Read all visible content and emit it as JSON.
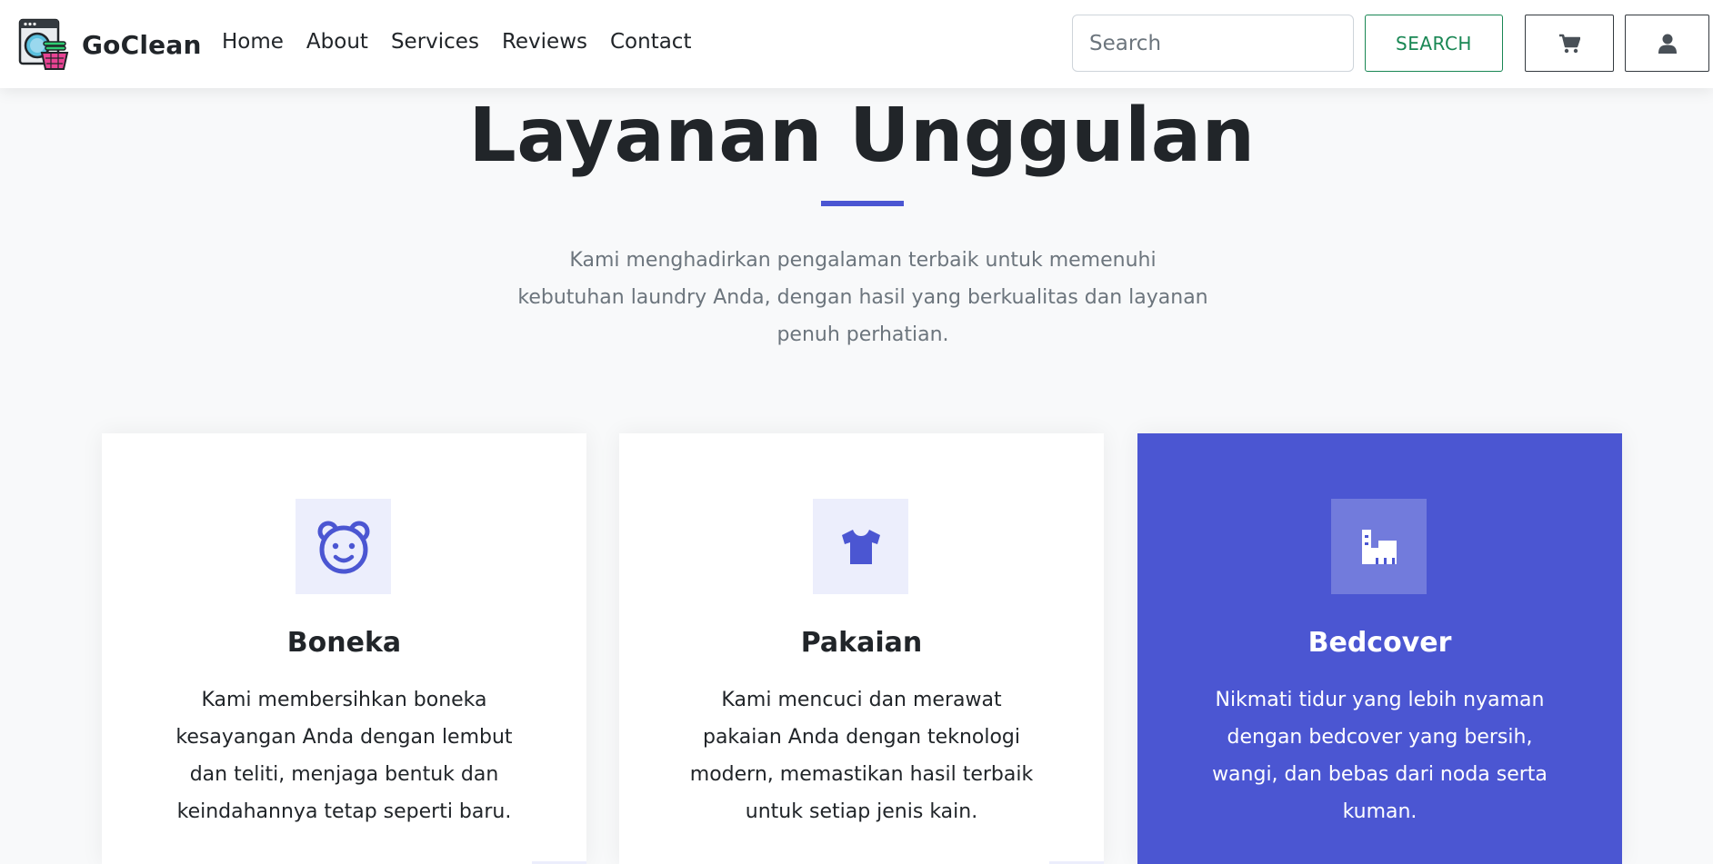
{
  "brand": {
    "name": "GoClean"
  },
  "nav": {
    "links": [
      {
        "label": "Home"
      },
      {
        "label": "About"
      },
      {
        "label": "Services"
      },
      {
        "label": "Reviews"
      },
      {
        "label": "Contact"
      }
    ]
  },
  "search": {
    "placeholder": "Search",
    "button_label": "SEARCH"
  },
  "header_icons": {
    "cart": "cart-icon",
    "user": "user-icon"
  },
  "section": {
    "title": "Layanan Unggulan",
    "description": "Kami menghadirkan pengalaman terbaik untuk memenuhi kebutuhan laundry Anda, dengan hasil yang berkualitas dan layanan penuh perhatian."
  },
  "cards": [
    {
      "icon": "teddy-bear-icon",
      "title": "Boneka",
      "text": "Kami membersihkan boneka kesayangan Anda dengan lembut dan teliti, menjaga bentuk dan keindahannya tetap seperti baru."
    },
    {
      "icon": "shirt-icon",
      "title": "Pakaian",
      "text": "Kami mencuci dan merawat pakaian Anda dengan teknologi modern, memastikan hasil terbaik untuk setiap jenis kain."
    },
    {
      "icon": "bed-icon",
      "title": "Bedcover",
      "text": "Nikmati tidur yang lebih nyaman dengan bedcover yang bersih, wangi, dan bebas dari noda serta kuman."
    }
  ],
  "colors": {
    "accent": "#4b56d2",
    "success": "#198754",
    "text": "#212529",
    "muted": "#6c757d",
    "icon_bg": "#eceefc"
  }
}
